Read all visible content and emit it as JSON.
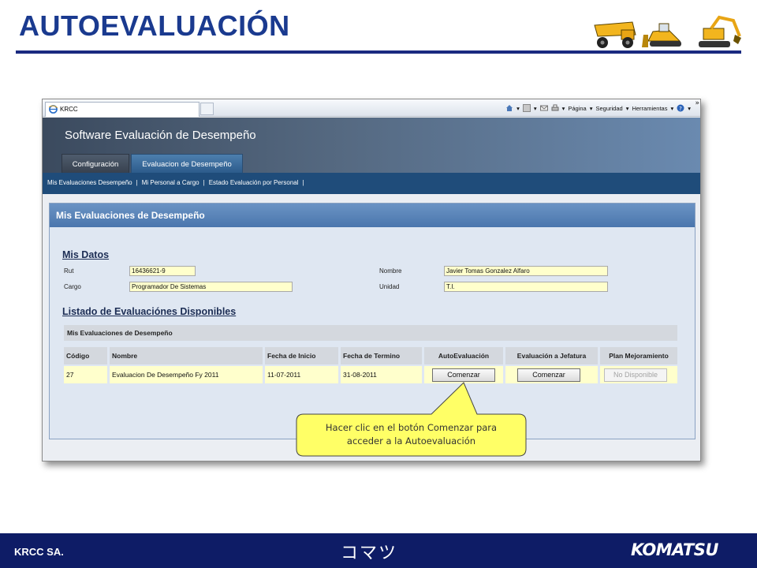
{
  "slide": {
    "title": "AUTOEVALUACIÓN",
    "footer_company": "KRCC SA.",
    "footer_kana": "コマツ",
    "footer_brand": "KOMATSU",
    "colors": {
      "title": "#1a3a8f",
      "footer": "#0e1c66",
      "callout_fill": "#ffff66",
      "field_fill": "#ffffcc"
    }
  },
  "browser": {
    "tab_title": "KRCC",
    "commands": [
      "Página",
      "Seguridad",
      "Herramientas"
    ],
    "icons": [
      "home-icon",
      "rss-icon",
      "mail-icon",
      "print-icon",
      "help-icon"
    ]
  },
  "app": {
    "title": "Software Evaluación de Desempeño",
    "tabs": [
      "Configuración",
      "Evaluacion de Desempeño"
    ],
    "active_tab": "Evaluacion de Desempeño",
    "subnav": [
      "Mis Evaluaciones Desempeño",
      "Mi Personal a Cargo",
      "Estado Evaluación por Personal"
    ]
  },
  "panel": {
    "title": "Mis Evaluaciones de Desempeño",
    "datos_heading": "Mis Datos",
    "fields": {
      "rut_label": "Rut",
      "rut_value": "16436621-9",
      "cargo_label": "Cargo",
      "cargo_value": "Programador De Sistemas",
      "nombre_label": "Nombre",
      "nombre_value": "Javier Tomas Gonzalez Alfaro",
      "unidad_label": "Unidad",
      "unidad_value": "T.I."
    },
    "listado_heading": "Listado de Evaluaciónes Disponibles",
    "table": {
      "caption": "Mis Evaluaciones de Desempeño",
      "headers": [
        "Código",
        "Nombre",
        "Fecha de Inicio",
        "Fecha de Termino",
        "AutoEvaluación",
        "Evaluación a Jefatura",
        "Plan Mejoramiento"
      ],
      "rows": [
        [
          "27",
          "Evaluacion De Desempeño Fy 2011",
          "11-07-2011",
          "31-08-2011",
          "Comenzar",
          "Comenzar",
          "No Disponible"
        ]
      ]
    }
  },
  "callout": {
    "line1": "Hacer clic en el botón Comenzar para",
    "line2": "acceder a la Autoevaluación"
  }
}
